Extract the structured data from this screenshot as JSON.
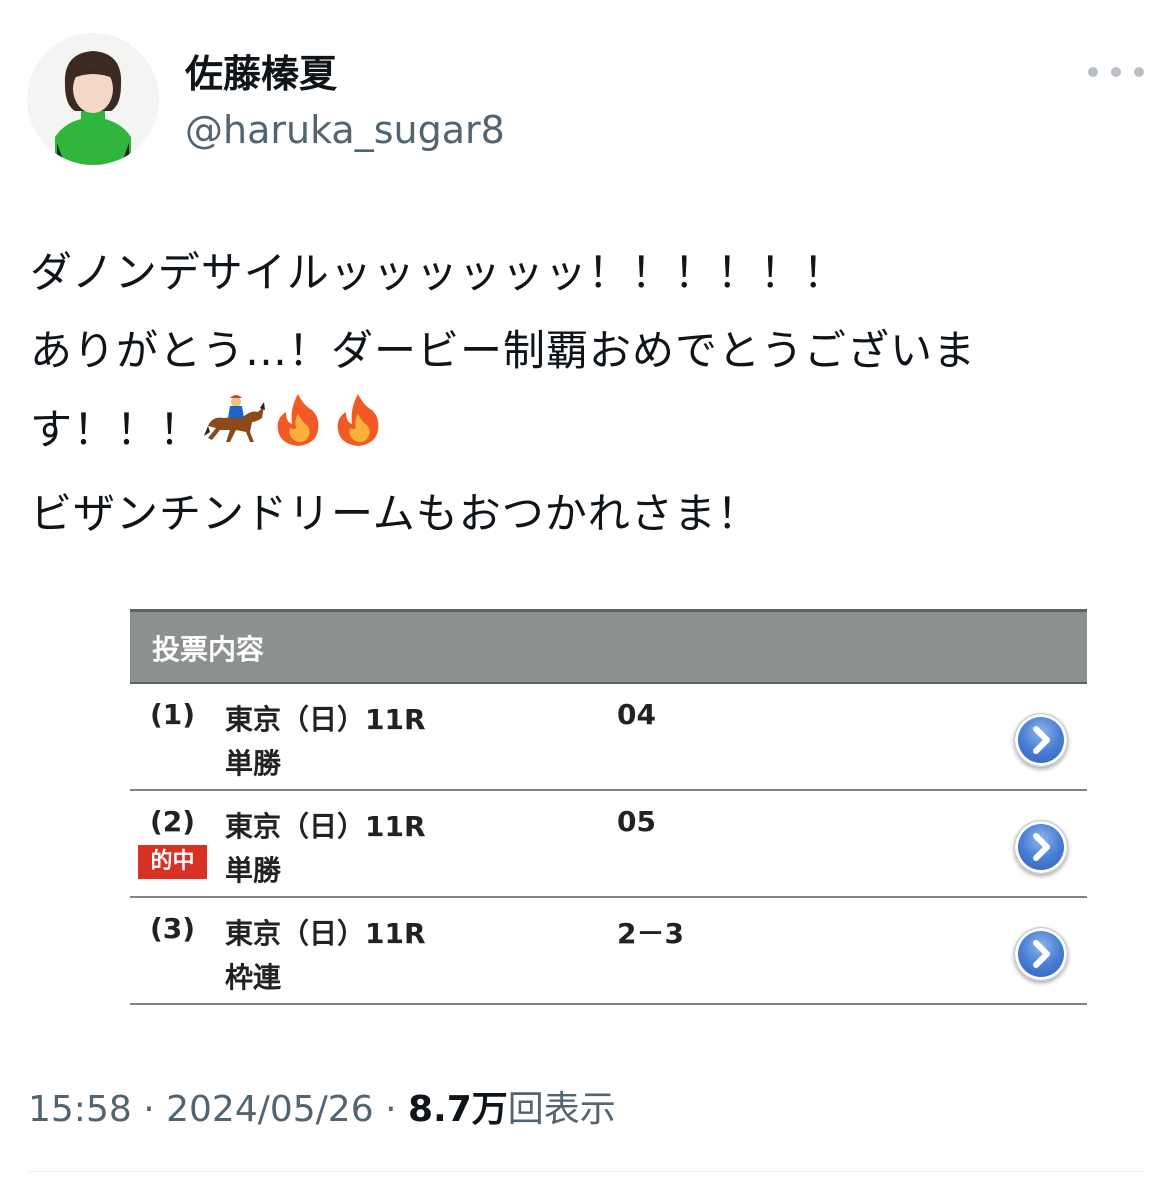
{
  "author": {
    "display_name": "佐藤榛夏",
    "handle": "@haruka_sugar8",
    "avatar_icon": "avatar-photo"
  },
  "more_icon": "more-horizontal-icon",
  "tweet": {
    "lines": [
      "ダノンデサイルッッッッッッ！！！！！！",
      "ありがとう…！ダービー制覇おめでとうございま",
      "す！！！"
    ],
    "last_line": "ビザンチンドリームもおつかれさま！",
    "emojis": [
      "horse-racing-emoji",
      "fire-emoji",
      "fire-emoji"
    ]
  },
  "bet_slip": {
    "header": "投票内容",
    "rows": [
      {
        "num": "(1)",
        "venue": "東京（日）11R",
        "type": "単勝",
        "combo": "04",
        "hit": ""
      },
      {
        "num": "(2)",
        "venue": "東京（日）11R",
        "type": "単勝",
        "combo": "05",
        "hit": "的中"
      },
      {
        "num": "(3)",
        "venue": "東京（日）11R",
        "type": "枠連",
        "combo": "2－3",
        "hit": ""
      }
    ],
    "header_color": "#8c918f",
    "hit_color": "#d93025"
  },
  "meta": {
    "time": "15:58",
    "separator": "·",
    "date": "2024/05/26",
    "views_count": "8.7万",
    "views_label": "回表示"
  }
}
